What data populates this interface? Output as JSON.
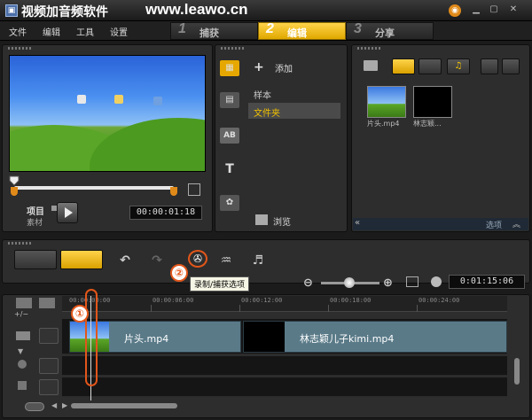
{
  "titlebar": {
    "app_title": "视频加音频软件",
    "watermark": "www.leawo.cn",
    "icons": [
      "app-icon",
      "logo-icon",
      "minimize-icon",
      "maximize-icon",
      "close-icon"
    ]
  },
  "menu": {
    "items": [
      "文件",
      "编辑",
      "工具",
      "设置"
    ]
  },
  "steps": [
    {
      "num": "1",
      "label": "捕获"
    },
    {
      "num": "2",
      "label": "编辑"
    },
    {
      "num": "3",
      "label": "分享"
    }
  ],
  "preview": {
    "project_label": "项目",
    "clip_label": "素材",
    "timecode": "00:00:01:18"
  },
  "library": {
    "add_label": "添加",
    "folders": [
      "样本",
      "文件夹"
    ],
    "browse_label": "浏览",
    "options_label": "选项",
    "items": [
      {
        "label": "片头.mp4"
      },
      {
        "label": "林志颖..."
      }
    ]
  },
  "timeline": {
    "tooltip": "录制/捕获选项",
    "callout_1": "①",
    "callout_2": "②",
    "duration": "0:01:15:06",
    "ruler": [
      "00:00:00:00",
      "00:00:06:00",
      "00:00:12:00",
      "00:00:18:00",
      "00:00:24:00"
    ],
    "clips": [
      {
        "name": "片头.mp4"
      },
      {
        "name": "林志颖儿子kimi.mp4"
      }
    ]
  },
  "colors": {
    "accent": "#f0b400",
    "callout": "#e2561a"
  }
}
